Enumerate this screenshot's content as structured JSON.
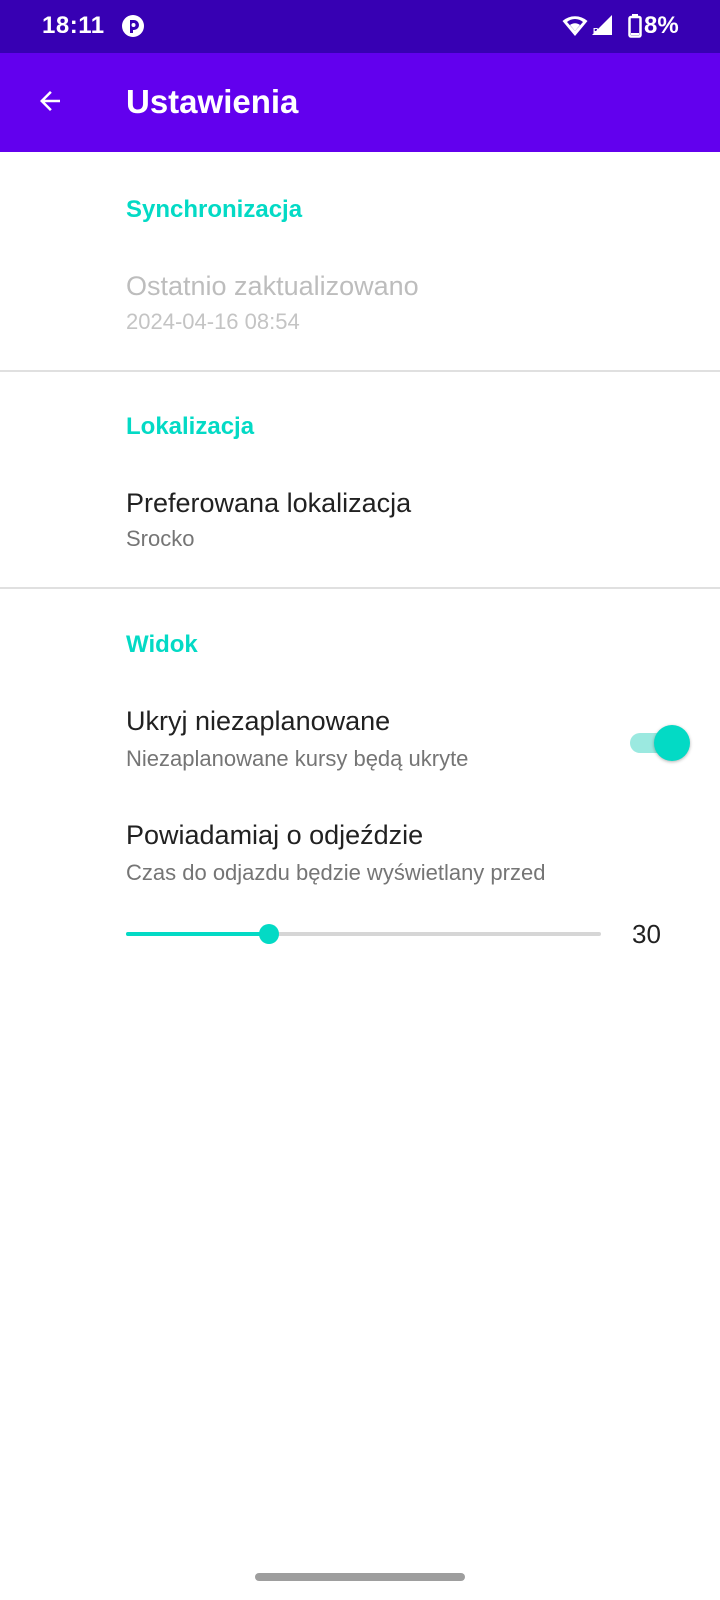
{
  "status_bar": {
    "time": "18:11",
    "battery": "8%",
    "icons": [
      "app-indicator-icon",
      "wifi-icon",
      "signal-icon",
      "battery-icon"
    ]
  },
  "app_bar": {
    "title": "Ustawienia",
    "back_icon": "arrow-back-icon"
  },
  "sections": {
    "sync": {
      "header": "Synchronizacja",
      "last_updated_title": "Ostatnio zaktualizowano",
      "last_updated_value": "2024-04-16 08:54"
    },
    "location": {
      "header": "Lokalizacja",
      "preferred_title": "Preferowana lokalizacja",
      "preferred_value": "Srocko"
    },
    "view": {
      "header": "Widok",
      "hide_unscheduled_title": "Ukryj niezaplanowane",
      "hide_unscheduled_summary": "Niezaplanowane kursy będą ukryte",
      "hide_unscheduled_enabled": true,
      "notify_title": "Powiadamiaj o odjeździe",
      "notify_summary": "Czas do odjazdu będzie wyświetlany przed",
      "notify_slider_value": "30",
      "notify_slider_fraction": 0.3
    }
  },
  "colors": {
    "status_bar": "#3700b3",
    "app_bar": "#6200ee",
    "accent": "#03dac5"
  }
}
